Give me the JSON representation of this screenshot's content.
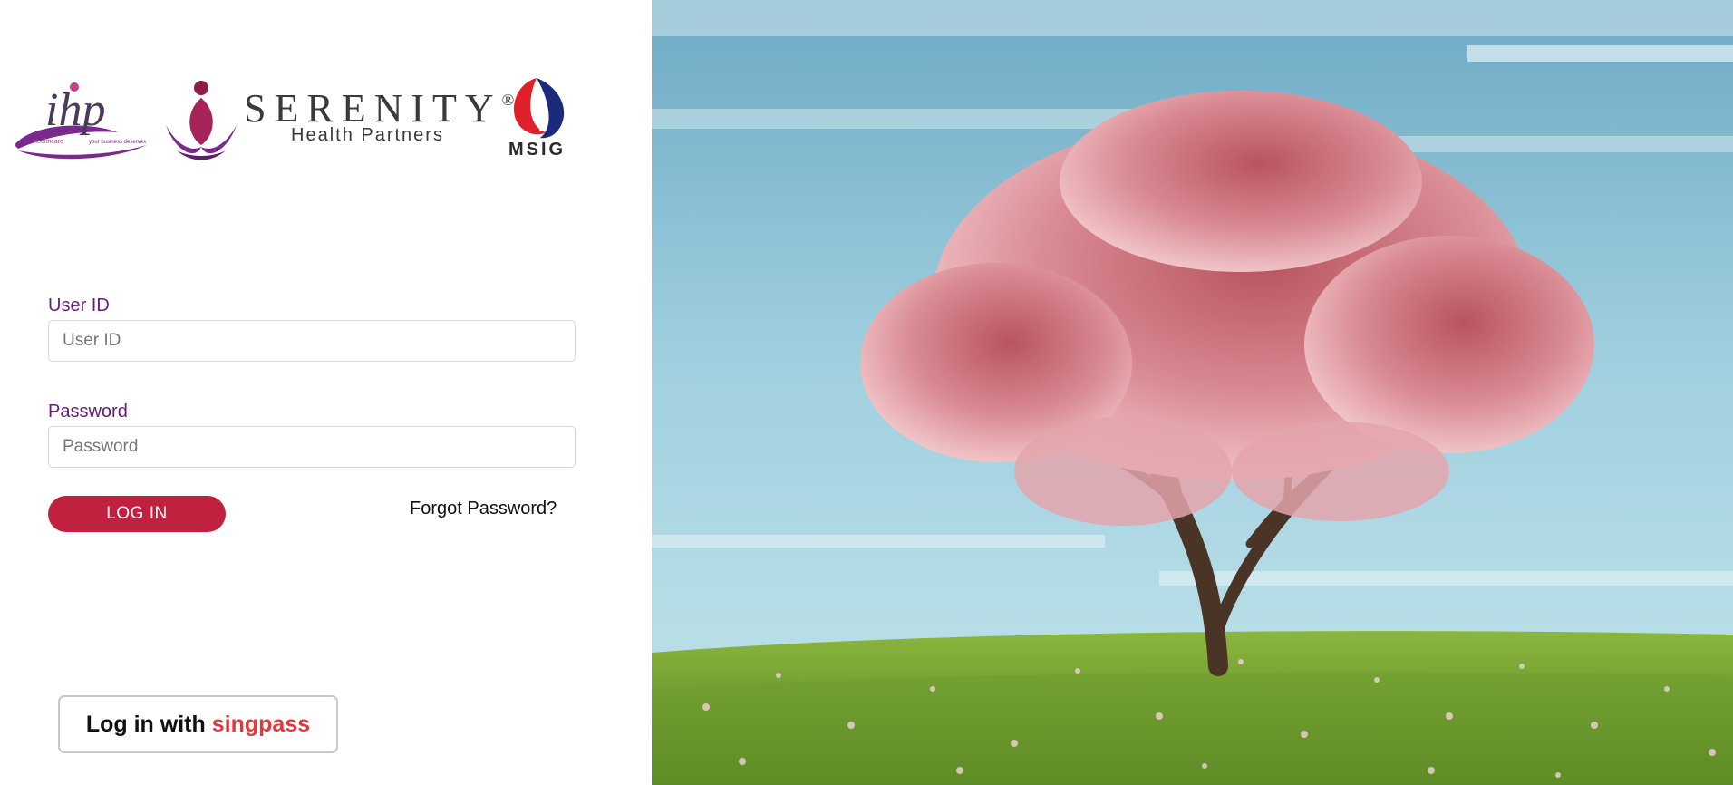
{
  "brand": {
    "ihp_wordmark": "ihp",
    "ihp_tagline_left": "Healthcare",
    "ihp_tagline_right": "your business deserves",
    "serenity_name": "SERENITY",
    "serenity_mark": "®",
    "serenity_sub": "Health Partners",
    "msig_name": "MSIG"
  },
  "form": {
    "user_id_label": "User ID",
    "user_id_placeholder": "User ID",
    "user_id_value": "",
    "password_label": "Password",
    "password_placeholder": "Password",
    "password_value": "",
    "login_label": "LOG IN",
    "forgot_label": "Forgot Password?"
  },
  "singpass": {
    "prefix": "Log in with",
    "brand": "singpass"
  },
  "colors": {
    "accent_purple": "#6b1a7f",
    "button_red": "#c0213f",
    "singpass_red": "#e03a3e",
    "sky": "#7fb9cf",
    "grass": "#6e9b2e",
    "blossom": "#d98a93"
  },
  "icons": {
    "ihp_logo": "ihp-logo-icon",
    "serenity_logo": "meditation-figure-icon",
    "msig_logo": "msig-emblem-icon"
  }
}
